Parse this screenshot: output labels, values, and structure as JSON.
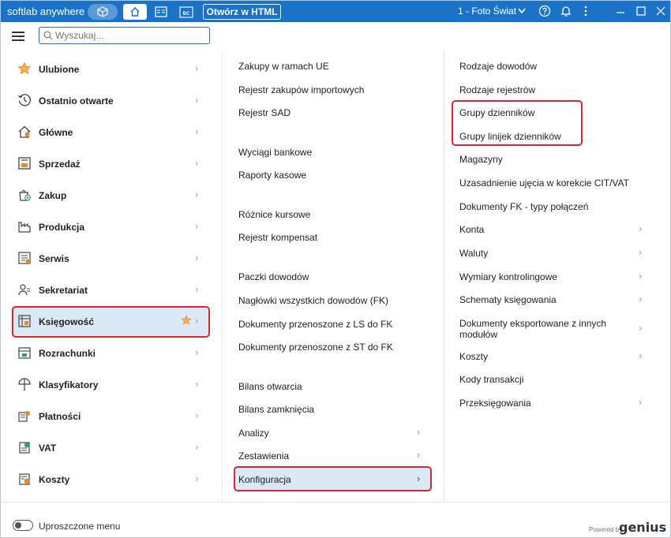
{
  "titlebar": {
    "app_name": "softlab anywhere",
    "open_html_label": "Otwórz w HTML",
    "company": "1 - Foto Świat",
    "bc_label": "BC"
  },
  "search": {
    "placeholder": "Wyszukaj..."
  },
  "left_menu": [
    {
      "label": "Ulubione",
      "icon": "star-icon"
    },
    {
      "label": "Ostatnio otwarte",
      "icon": "history-icon"
    },
    {
      "label": "Główne",
      "icon": "home-icon"
    },
    {
      "label": "Sprzedaż",
      "icon": "sales-icon"
    },
    {
      "label": "Zakup",
      "icon": "purchase-icon"
    },
    {
      "label": "Produkcja",
      "icon": "factory-icon"
    },
    {
      "label": "Serwis",
      "icon": "service-icon"
    },
    {
      "label": "Sekretariat",
      "icon": "secretary-icon"
    },
    {
      "label": "Księgowość",
      "icon": "accounting-icon",
      "active": true
    },
    {
      "label": "Rozrachunki",
      "icon": "settlements-icon"
    },
    {
      "label": "Klasyfikatory",
      "icon": "classifiers-icon"
    },
    {
      "label": "Płatności",
      "icon": "payments-icon"
    },
    {
      "label": "VAT",
      "icon": "vat-icon"
    },
    {
      "label": "Koszty",
      "icon": "costs-icon"
    }
  ],
  "middle_menu": [
    {
      "label": "Zakupy w ramach UE"
    },
    {
      "label": "Rejestr zakupów importowych"
    },
    {
      "label": "Rejestr SAD"
    },
    {
      "label": "Wyciągi bankowe"
    },
    {
      "label": "Raporty kasowe"
    },
    {
      "label": "Różnice kursowe"
    },
    {
      "label": "Rejestr kompensat"
    },
    {
      "label": "Paczki dowodów"
    },
    {
      "label": "Nagłówki wszystkich dowodów (FK)"
    },
    {
      "label": "Dokumenty przenoszone z LS do FK"
    },
    {
      "label": "Dokumenty przenoszone z ST do FK"
    },
    {
      "label": "Bilans otwarcia"
    },
    {
      "label": "Bilans zamknięcia"
    },
    {
      "label": "Analizy",
      "submenu": true
    },
    {
      "label": "Zestawienia",
      "submenu": true
    },
    {
      "label": "Konfiguracja",
      "submenu": true,
      "active": true
    }
  ],
  "right_menu": [
    {
      "label": "Rodzaje dowodów"
    },
    {
      "label": "Rodzaje rejestrów"
    },
    {
      "label": "Grupy dzienników"
    },
    {
      "label": "Grupy linijek dzienników"
    },
    {
      "label": "Magazyny"
    },
    {
      "label": "Uzasadnienie ujęcia w korekcie CIT/VAT"
    },
    {
      "label": "Dokumenty FK - typy połączeń"
    },
    {
      "label": "Konta",
      "submenu": true
    },
    {
      "label": "Waluty",
      "submenu": true
    },
    {
      "label": "Wymiary kontrolingowe",
      "submenu": true
    },
    {
      "label": "Schematy księgowania",
      "submenu": true
    },
    {
      "label": "Dokumenty eksportowane z innych modułów",
      "submenu": true
    },
    {
      "label": "Koszty",
      "submenu": true
    },
    {
      "label": "Kody transakcji"
    },
    {
      "label": "Przeksięgowania",
      "submenu": true
    }
  ],
  "footer": {
    "simplified_menu_label": "Uproszczone menu",
    "powered_by": "Powered by",
    "brand": "genius"
  },
  "colors": {
    "titlebar": "#1a73c9",
    "highlight": "#e0242c",
    "active_bg": "#dbe9f6"
  }
}
